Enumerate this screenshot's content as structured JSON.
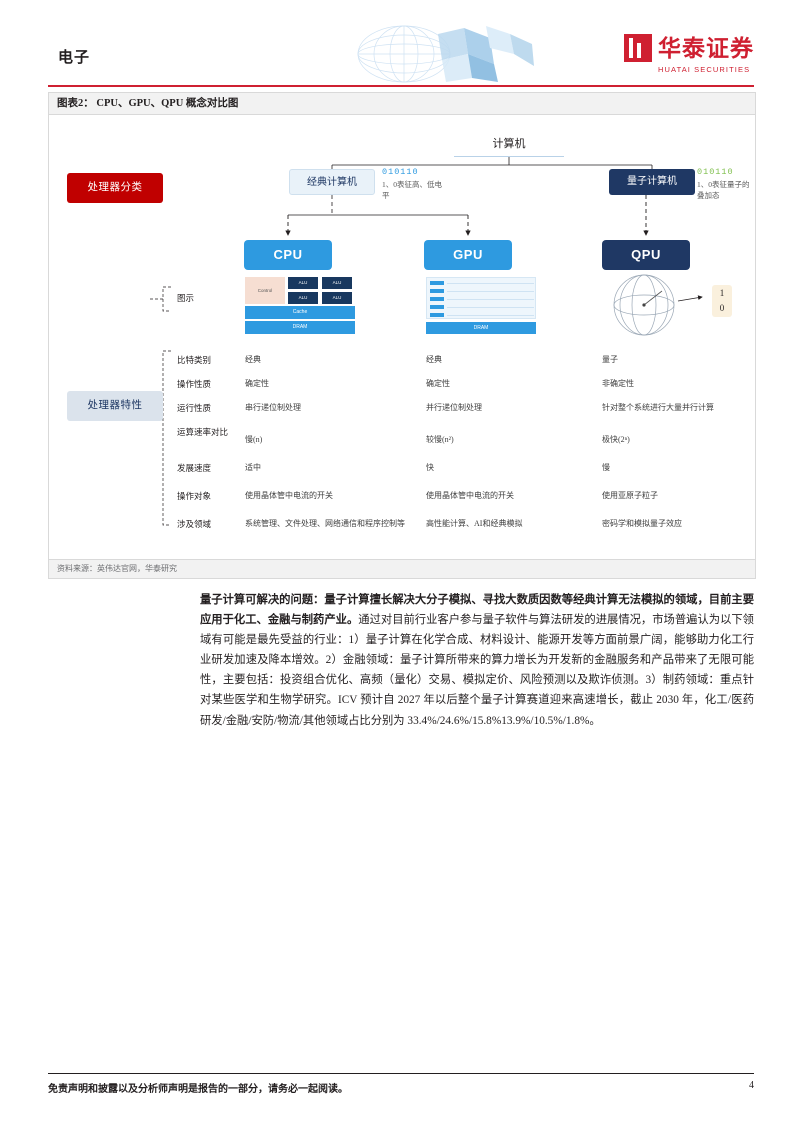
{
  "header": {
    "title": "电子",
    "logo_cn": "华泰证券",
    "logo_en": "HUATAI SECURITIES"
  },
  "exhibit": {
    "caption": "图表2： CPU、GPU、QPU 概念对比图",
    "source": "资料来源：英伟达官网，华泰研究"
  },
  "diagram": {
    "root": "计算机",
    "classic": "经典计算机",
    "quantum": "量子计算机",
    "side_labels": {
      "processor_type": "处理器分类",
      "processor_feature": "处理器特性",
      "legend": "图示"
    },
    "bits_classic": "010110",
    "bits_classic_note": "1、0表征高、低电平",
    "bits_quantum": "010110",
    "bits_quantum_note": "1、0表征量子的叠加态",
    "chips": {
      "cpu": "CPU",
      "gpu": "GPU",
      "qpu": "QPU"
    },
    "cpu_diagram": {
      "control": "Control",
      "alu": "ALU",
      "cache": "Cache",
      "dram": "DRAM"
    },
    "gpu_diagram": {
      "dram": "DRAM"
    },
    "qpu_diagram": {
      "ket_one": "1",
      "ket_zero": "0"
    },
    "rows": [
      {
        "label": "比特类别",
        "cpu": "经典",
        "gpu": "经典",
        "qpu": "量子"
      },
      {
        "label": "操作性质",
        "cpu": "确定性",
        "gpu": "确定性",
        "qpu": "非确定性"
      },
      {
        "label": "运行性质",
        "cpu": "串行递位制处理",
        "gpu": "并行递位制处理",
        "qpu": "针对整个系统进行大量并行计算"
      },
      {
        "label": "运算速率对比",
        "cpu": "慢(n)",
        "gpu": "较慢(n²)",
        "qpu": "极快(2ⁿ)"
      },
      {
        "label": "发展速度",
        "cpu": "适中",
        "gpu": "快",
        "qpu": "慢"
      },
      {
        "label": "操作对象",
        "cpu": "使用晶体管中电流的开关",
        "gpu": "使用晶体管中电流的开关",
        "qpu": "使用亚原子粒子"
      },
      {
        "label": "涉及领域",
        "cpu": "系统管理、文件处理、网络通信和程序控制等",
        "gpu": "高性能计算、AI和经典模拟",
        "qpu": "密码学和模拟量子效应"
      }
    ]
  },
  "body": {
    "paragraph_lead": "量子计算可解决的问题：量子计算擅长解决大分子模拟、寻找大数质因数等经典计算无法模拟的领域，目前主要应用于化工、金融与制药产业。",
    "paragraph_rest": "通过对目前行业客户参与量子软件与算法研发的进展情况，市场普遍认为以下领域有可能是最先受益的行业：1）量子计算在化学合成、材料设计、能源开发等方面前景广阔，能够助力化工行业研发加速及降本增效。2）金融领域：量子计算所带来的算力增长为开发新的金融服务和产品带来了无限可能性，主要包括：投资组合优化、高频（量化）交易、模拟定价、风险预测以及欺诈侦测。3）制药领域：重点针对某些医学和生物学研究。ICV 预计自 2027 年以后整个量子计算赛道迎来高速增长，截止 2030 年，化工/医药研发/金融/安防/物流/其他领域占比分别为 33.4%/24.6%/15.8%13.9%/10.5%/1.8%。"
  },
  "footer": {
    "disclaimer": "免责声明和披露以及分析师声明是报告的一部分，请务必一起阅读。",
    "page_number": "4"
  }
}
